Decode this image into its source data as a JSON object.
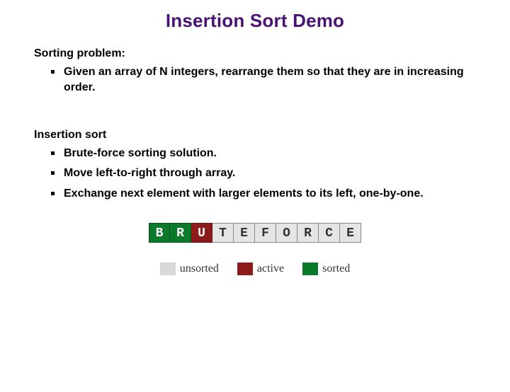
{
  "title": "Insertion Sort Demo",
  "problem": {
    "heading": "Sorting problem:",
    "bullets": [
      "Given an array of N integers, rearrange them so that they are in increasing order."
    ]
  },
  "method": {
    "heading": "Insertion sort",
    "bullets": [
      "Brute-force sorting solution.",
      "Move left-to-right through array.",
      "Exchange next element with larger elements to its left, one-by-one."
    ]
  },
  "array": [
    {
      "letter": "B",
      "state": "sorted"
    },
    {
      "letter": "R",
      "state": "sorted"
    },
    {
      "letter": "U",
      "state": "active"
    },
    {
      "letter": "T",
      "state": "unsorted"
    },
    {
      "letter": "E",
      "state": "unsorted"
    },
    {
      "letter": "F",
      "state": "unsorted"
    },
    {
      "letter": "O",
      "state": "unsorted"
    },
    {
      "letter": "R",
      "state": "unsorted"
    },
    {
      "letter": "C",
      "state": "unsorted"
    },
    {
      "letter": "E",
      "state": "unsorted"
    }
  ],
  "legend": {
    "unsorted": "unsorted",
    "active": "active",
    "sorted": "sorted"
  }
}
